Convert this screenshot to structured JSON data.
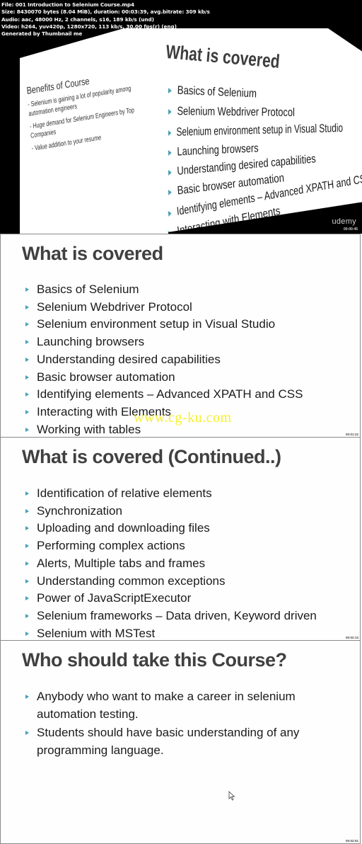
{
  "file_info": {
    "lines": [
      "File: 001 Introduction to Selenium Course.mp4",
      "Size: 8430070 bytes (8.04 MiB), duration: 00:03:39, avg.bitrate: 309 kb/s",
      "Audio: aac, 48000 Hz, 2 channels, s16, 189 kb/s (und)",
      "Video: h264, yuv420p, 1280x720, 113 kb/s, 30.00 fps(r) (eng)",
      "Generated by Thumbnail me"
    ]
  },
  "frames": [
    {
      "transition": {
        "left_slide": {
          "title": "Benefits of Course",
          "items": [
            {
              "line1": "Selenium is gaining a lot of popularity among",
              "line2": "automation engineers"
            },
            {
              "line1": "Huge demand for Selenium Engineers by Top",
              "line2": "Companies"
            },
            {
              "line1": "Value addition to your resume",
              "line2": ""
            }
          ]
        },
        "right_slide": {
          "title": "What is covered",
          "items": [
            "Basics of Selenium",
            "Selenium Webdriver Protocol",
            "Selenium environment setup in Visual Studio",
            "Launching browsers",
            "Understanding desired capabilities",
            "Basic browser automation",
            "Identifying elements – Advanced XPATH and CSS",
            "Interacting with Elements"
          ]
        }
      },
      "brand": "udemy",
      "timestamp": "00:00:45"
    },
    {
      "title": "What is covered",
      "items": [
        "Basics of Selenium",
        "Selenium Webdriver Protocol",
        "Selenium environment setup in Visual Studio",
        "Launching browsers",
        "Understanding desired capabilities",
        "Basic browser automation",
        "Identifying elements – Advanced XPATH and CSS",
        "Interacting with Elements",
        "Working with tables"
      ],
      "timestamp": "00:01:22"
    },
    {
      "title": "What is covered (Continued..)",
      "items": [
        "Identification of relative elements",
        "Synchronization",
        "Uploading and downloading files",
        "Performing complex actions",
        "Alerts, Multiple tabs and frames",
        "Understanding common exceptions",
        "Power of JavaScriptExecutor",
        "Selenium frameworks – Data driven, Keyword driven",
        "Selenium with MSTest"
      ],
      "timestamp": "00:02:13"
    },
    {
      "title": "Who should take this Course?",
      "items": [
        "Anybody who want to make a career in selenium automation testing.",
        "Students should have basic understanding of any programming language."
      ],
      "timestamp": "00:02:51"
    }
  ],
  "watermark": "www.cg-ku.com",
  "colors": {
    "bullet": "#4a9fb6",
    "title": "#404040",
    "watermark": "#f5f01a"
  }
}
